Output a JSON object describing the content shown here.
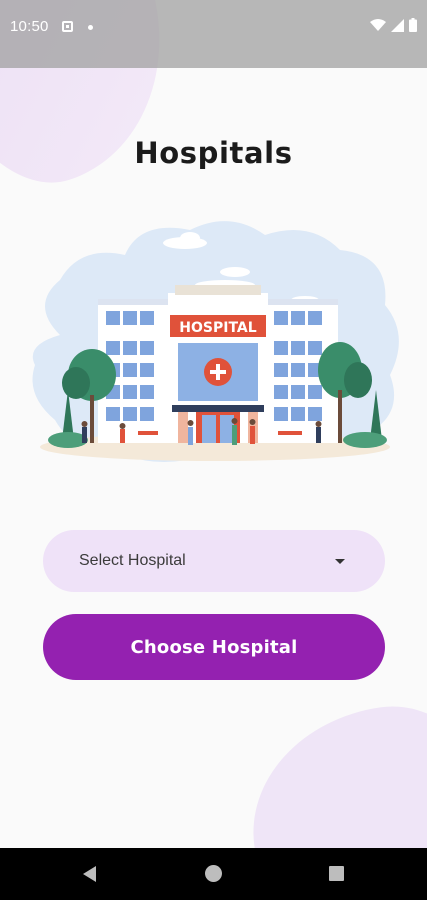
{
  "status_bar": {
    "time": "10:50",
    "icons": [
      "notification-app-icon",
      "dot-icon",
      "wifi-icon",
      "signal-icon",
      "battery-icon"
    ]
  },
  "page": {
    "title": "Hospitals"
  },
  "illustration": {
    "name": "hospital-illustration",
    "sign_text": "HOSPITAL"
  },
  "hospital_select": {
    "selected": "Select Hospital"
  },
  "choose_button": {
    "label": "Choose Hospital"
  },
  "colors": {
    "accent": "#9421b0",
    "select_bg": "#efe2f8",
    "blob": "#efe5f7"
  },
  "nav_bar": {
    "icons": [
      "back-icon",
      "home-icon",
      "recents-icon"
    ]
  }
}
